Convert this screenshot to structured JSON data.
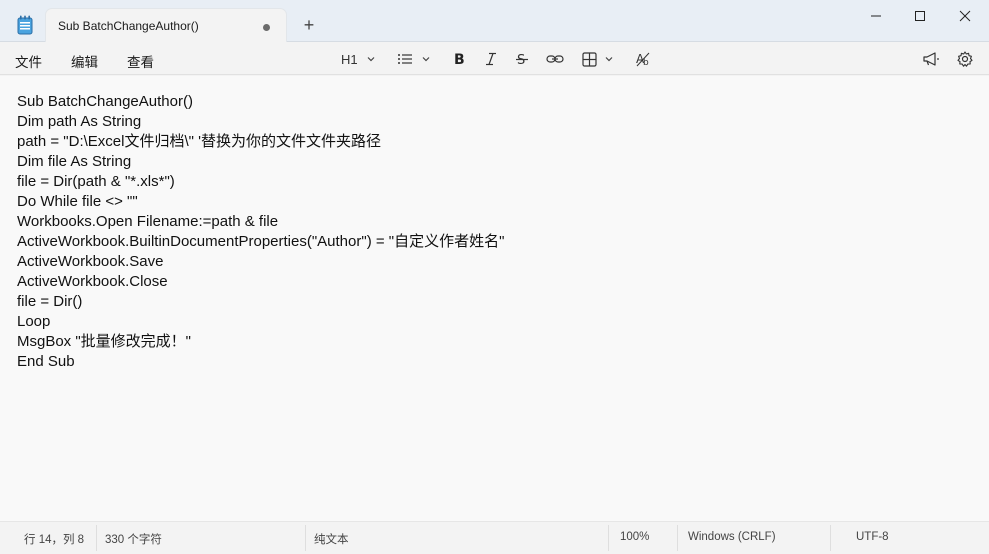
{
  "tab": {
    "title": "Sub BatchChangeAuthor()",
    "new_tab_label": "+"
  },
  "menu": {
    "file": "文件",
    "edit": "编辑",
    "view": "查看"
  },
  "toolbar": {
    "heading": "H1"
  },
  "document": {
    "lines": [
      "Sub BatchChangeAuthor()",
      "Dim path As String",
      "path = \"D:\\Excel文件归档\\\" '替换为你的文件文件夹路径",
      "Dim file As String",
      "file = Dir(path & \"*.xls*\")",
      "Do While file <> \"\"",
      "Workbooks.Open Filename:=path & file",
      "ActiveWorkbook.BuiltinDocumentProperties(\"Author\") = \"自定义作者姓名\"",
      "ActiveWorkbook.Save",
      "ActiveWorkbook.Close",
      "file = Dir()",
      "Loop",
      "MsgBox \"批量修改完成！\"",
      "End Sub"
    ]
  },
  "status": {
    "position": "行 14，列 8",
    "char_count": "330 个字符",
    "format": "纯文本",
    "zoom": "100%",
    "line_ending": "Windows (CRLF)",
    "encoding": "UTF-8"
  }
}
